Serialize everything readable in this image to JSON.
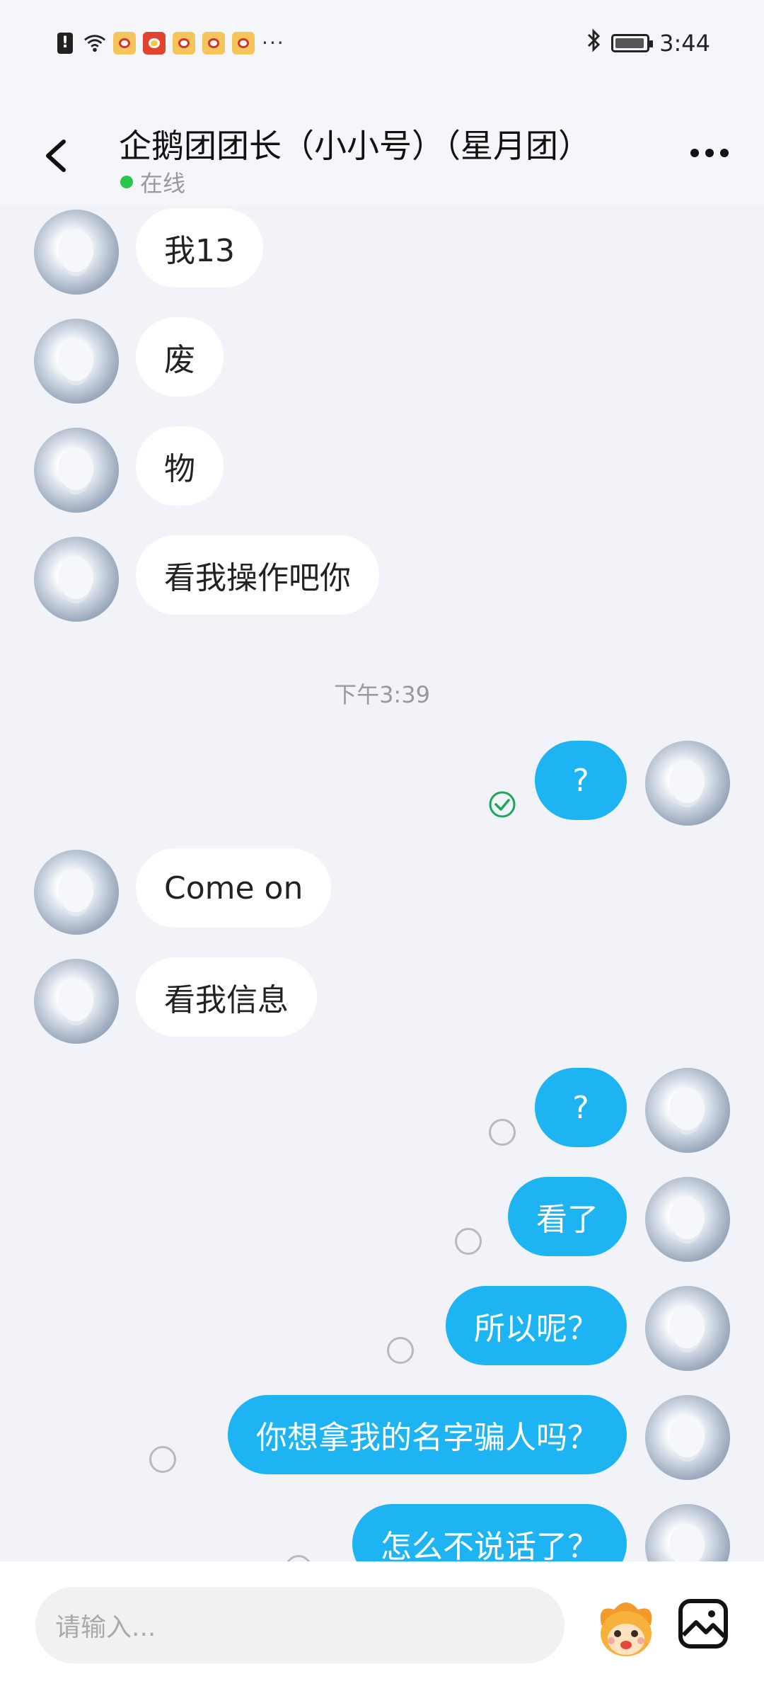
{
  "status_bar": {
    "time": "3:44",
    "more": "···",
    "icons": [
      "alert-icon",
      "wifi-icon",
      "weibo-icon",
      "qq-app-icon",
      "weibo-icon",
      "weibo-icon",
      "weibo-icon",
      "bluetooth-icon",
      "battery-icon"
    ]
  },
  "header": {
    "title": "企鹅团团长（小小号）（星月团）",
    "status": "在线"
  },
  "chat": {
    "messages_before": [
      {
        "direction": "in",
        "text": "我13"
      },
      {
        "direction": "in",
        "text": "废"
      },
      {
        "direction": "in",
        "text": "物"
      },
      {
        "direction": "in",
        "text": "看我操作吧你"
      }
    ],
    "timestamp": "下午3:39",
    "messages_after": [
      {
        "direction": "out",
        "text": "?",
        "status": "read"
      },
      {
        "direction": "in",
        "text": "Come on"
      },
      {
        "direction": "in",
        "text": "看我信息"
      },
      {
        "direction": "out",
        "text": "?",
        "status": "sent"
      },
      {
        "direction": "out",
        "text": "看了",
        "status": "sent"
      },
      {
        "direction": "out",
        "text": "所以呢？",
        "status": "sent"
      },
      {
        "direction": "out",
        "text": "你想拿我的名字骗人吗？",
        "status": "sent"
      },
      {
        "direction": "out",
        "text": "怎么不说话了？",
        "status": "sent"
      }
    ]
  },
  "input": {
    "placeholder": "请输入..."
  },
  "colors": {
    "outgoing_bubble": "#1eb4f4",
    "incoming_bubble": "#ffffff",
    "online_dot": "#28c64c",
    "read_check": "#19a85a"
  }
}
